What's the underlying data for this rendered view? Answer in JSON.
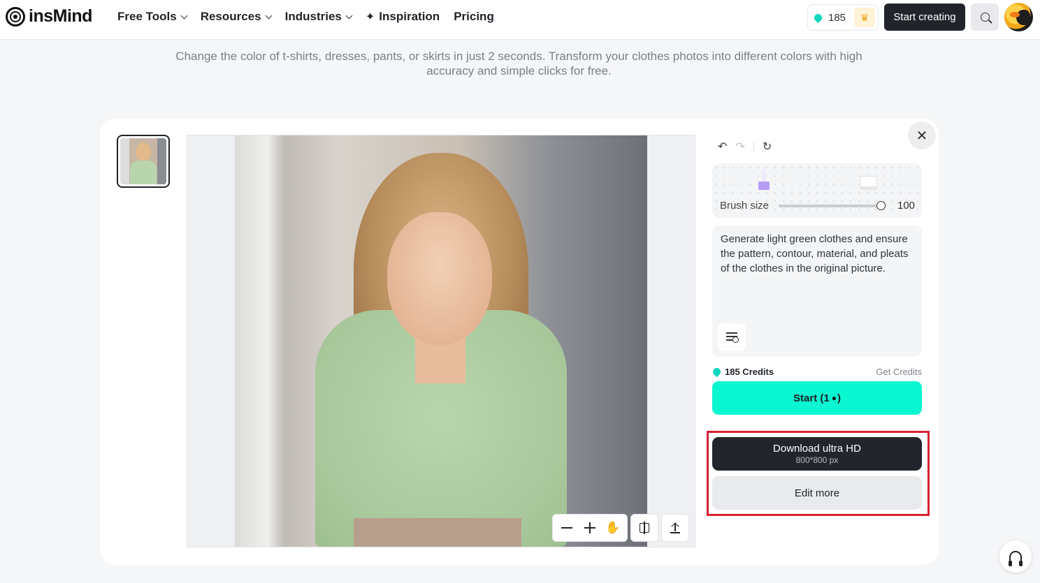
{
  "nav": {
    "logo": "insMind",
    "menu": [
      {
        "label": "Free Tools",
        "dropdown": true
      },
      {
        "label": "Resources",
        "dropdown": true
      },
      {
        "label": "Industries",
        "dropdown": true
      },
      {
        "label": "Inspiration",
        "dropdown": false
      },
      {
        "label": "Pricing",
        "dropdown": false
      }
    ],
    "credits": "185",
    "start_button": "Start creating"
  },
  "subtitle": "Change the color of t-shirts, dresses, pants, or skirts in just 2 seconds. Transform your clothes photos into different colors with high accuracy and simple clicks for free.",
  "editor": {
    "brush": {
      "label": "Brush size",
      "value": "100",
      "level_fraction": 1.0
    },
    "prompt": "Generate light green clothes and ensure the pattern, contour, material, and pleats of the clothes in the original picture.",
    "credits_label": "185 Credits",
    "get_credits": "Get Credits",
    "start_label": "Start (1",
    "start_suffix": ")",
    "download": {
      "title": "Download ultra HD",
      "subtitle": "800*800 px"
    },
    "edit_more": "Edit more"
  },
  "colors": {
    "accent": "#0af7d2",
    "highlight_border": "#d92133",
    "dark_button": "#22262c"
  }
}
